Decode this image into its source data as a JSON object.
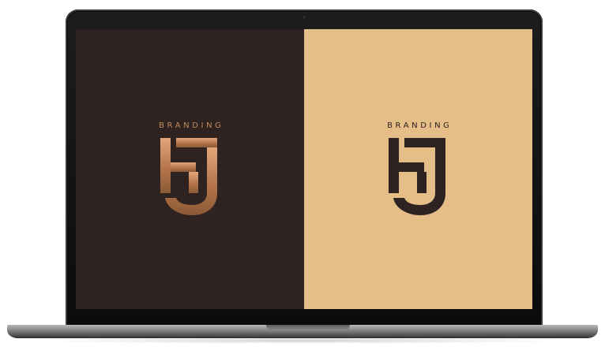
{
  "screen": {
    "left_panel": {
      "brand_word": "BRANDING",
      "background": "#2e2321",
      "logo_gradient": [
        "#e3a77a",
        "#b6754a",
        "#8a5a36"
      ]
    },
    "right_panel": {
      "brand_word": "BRANDING",
      "background": "#e4bd87",
      "logo_color": "#2e2321"
    }
  },
  "device": {
    "type": "laptop",
    "bezel_color": "#111111",
    "base_color": "#8d8d8d"
  }
}
